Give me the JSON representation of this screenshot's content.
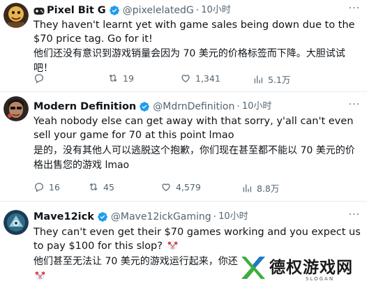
{
  "tweets": [
    {
      "name": "Pixel Bit G",
      "handle": "@pixelelatedG",
      "time": "10小时",
      "text_en": "They haven't learnt yet with game sales being down due to the $70 price tag.  Go for it!",
      "text_zh": "他们还没有意识到游戏销量会因为 70 美元的价格标签而下降。大胆试试吧！",
      "replies": "",
      "reposts": "19",
      "likes": "1,341",
      "views": "5.1万"
    },
    {
      "name": "Modern Definition",
      "handle": "@MdrnDefinition",
      "time": "10小时",
      "text_en": "Yeah nobody else can get away with that sorry, y'all can't even sell your game for 70 at this point lmao",
      "text_zh": "是的，没有其他人可以逃脱这个抱歉，你们现在甚至都不能以 70 美元的价格出售您的游戏 lmao",
      "replies": "16",
      "reposts": "45",
      "likes": "4,579",
      "views": "8.8万"
    },
    {
      "name": "Mave12ick",
      "handle": "@Mave12ickGaming",
      "time": "10小时",
      "text_en": "They can't even get their $70 games working and you expect us to pay $100 for this slop?",
      "text_zh": "他们甚至无法让 70 美元的游戏运行起来，你还"
    }
  ],
  "watermark": {
    "title": "德权游戏网",
    "slogan": "SLOGAN"
  },
  "icons": {
    "verified": "verified-badge-icon",
    "reply": "reply-icon",
    "repost": "repost-icon",
    "like": "like-icon",
    "views": "views-icon",
    "more": "more-icon",
    "clown": "clown-emoji"
  },
  "colors": {
    "verified": "#1d9bf0",
    "secondary_text": "#536471",
    "watermark_green": "#3cae3c"
  }
}
